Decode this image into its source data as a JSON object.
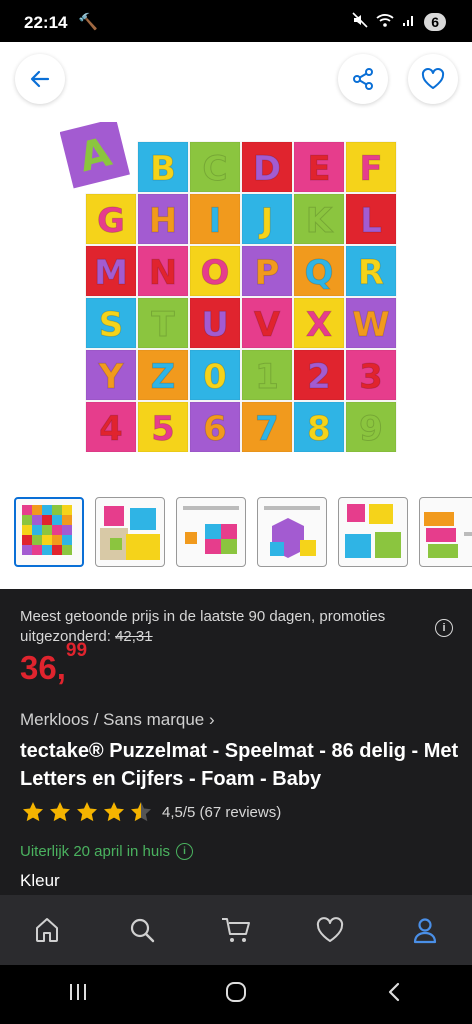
{
  "status": {
    "time": "22:14",
    "notification_count": "6"
  },
  "hero": {
    "tile_letter": "A",
    "grid": [
      [
        "B",
        "C",
        "D",
        "E",
        "F"
      ],
      [
        "G",
        "H",
        "I",
        "J",
        "K",
        "L"
      ],
      [
        "M",
        "N",
        "O",
        "P",
        "Q",
        "R"
      ],
      [
        "S",
        "T",
        "U",
        "V",
        "X",
        "W"
      ],
      [
        "Y",
        "Z",
        "0",
        "1",
        "2",
        "3"
      ],
      [
        "4",
        "5",
        "6",
        "7",
        "8",
        "9"
      ]
    ]
  },
  "thumbnails": [
    "thumb-1",
    "thumb-2",
    "thumb-3",
    "thumb-4",
    "thumb-5",
    "thumb-6"
  ],
  "product": {
    "promo_text": "Meest getoonde prijs in de laatste 90 dagen, promoties uitgezonderd:",
    "old_price": "42,31",
    "price_main": "36,",
    "price_cents": "99",
    "brand": "Merkloos / Sans marque",
    "title": "tectake® Puzzelmat - Speelmat - 86 delig - Met Letters en Cijfers - Foam - Baby",
    "rating_value": 4.5,
    "rating_text": "4,5/5 (67 reviews)",
    "delivery": "Uiterlijk 20 april in huis",
    "color_label": "Kleur"
  },
  "colors": {
    "accent_blue": "#0a6fd6",
    "price_red": "#e0242e",
    "delivery_green": "#4ab25f",
    "star_yellow": "#f5b400"
  }
}
